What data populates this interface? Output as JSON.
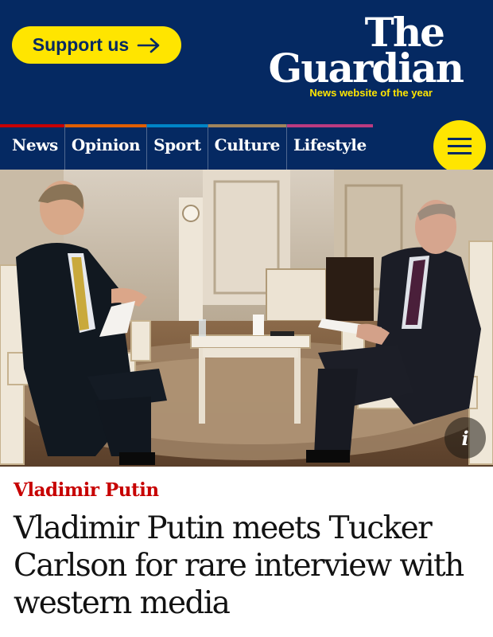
{
  "header": {
    "support_label": "Support us",
    "logo_line1": "The",
    "logo_line2": "Guardian",
    "tagline": "News website of the year",
    "colors": {
      "background": "#052962",
      "accent": "#ffe500"
    }
  },
  "nav": {
    "items": [
      {
        "label": "News",
        "color": "#c70000"
      },
      {
        "label": "Opinion",
        "color": "#e05e00"
      },
      {
        "label": "Sport",
        "color": "#0084c6"
      },
      {
        "label": "Culture",
        "color": "#a1845c"
      },
      {
        "label": "Lifestyle",
        "color": "#bb3b80"
      }
    ],
    "menu_icon": "hamburger-icon"
  },
  "photo": {
    "info_icon": "info-icon",
    "info_glyph": "i"
  },
  "article": {
    "kicker": "Vladimir Putin",
    "headline": "Vladimir Putin meets Tucker Carlson for rare interview with western media",
    "kicker_color": "#c70000"
  }
}
